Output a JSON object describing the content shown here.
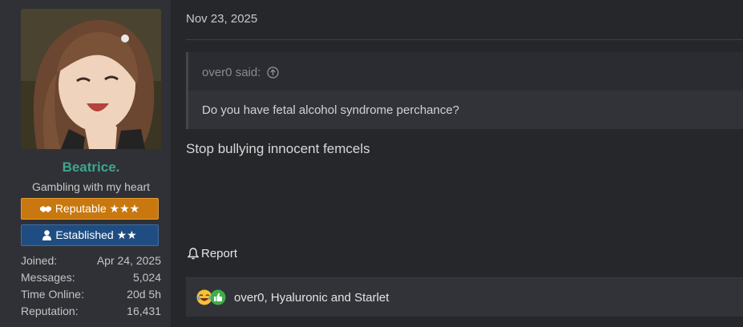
{
  "user": {
    "name": "Beatrice.",
    "title": "Gambling with my heart",
    "badges": [
      {
        "label": "Reputable ★★★",
        "icon": "handshake-icon"
      },
      {
        "label": "Established ★★",
        "icon": "user-icon"
      }
    ],
    "stats": [
      {
        "label": "Joined:",
        "value": "Apr 24, 2025"
      },
      {
        "label": "Messages:",
        "value": "5,024"
      },
      {
        "label": "Time Online:",
        "value": "20d 5h"
      },
      {
        "label": "Reputation:",
        "value": "16,431"
      }
    ]
  },
  "post": {
    "date": "Nov 23, 2025",
    "quote": {
      "author": "over0 said:",
      "text": "Do you have fetal alcohol syndrome perchance?"
    },
    "body": "Stop bullying innocent femcels",
    "report_label": "Report",
    "reactions": {
      "icons": [
        "laughing-emoji-icon",
        "thumbs-up-icon"
      ],
      "text": "over0, Hyaluronic and Starlet"
    }
  },
  "colors": {
    "username": "#3fa58e",
    "reputable": "#c8780e",
    "established": "#1f4d82"
  }
}
